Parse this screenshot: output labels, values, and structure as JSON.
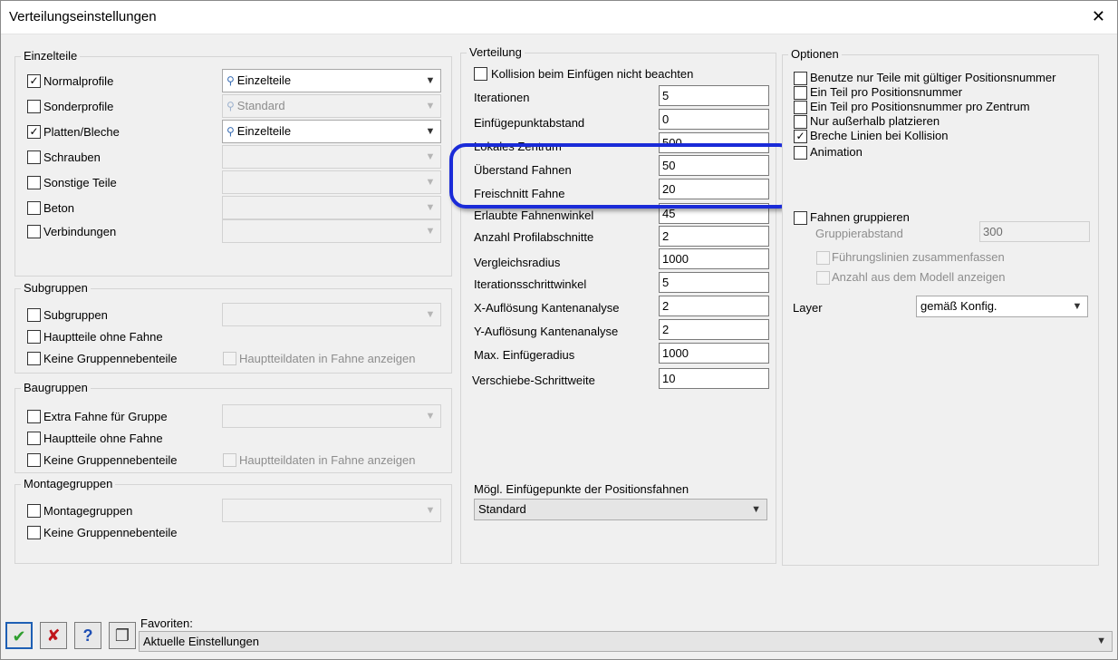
{
  "window": {
    "title": "Verteilungseinstellungen",
    "close": "✕"
  },
  "einzelteile": {
    "title": "Einzelteile",
    "rows": [
      {
        "label": "Normalprofile",
        "checked": "✓",
        "combo": "Einzelteile"
      },
      {
        "label": "Sonderprofile",
        "checked": "",
        "combo": "Standard"
      },
      {
        "label": "Platten/Bleche",
        "checked": "✓",
        "combo": "Einzelteile"
      },
      {
        "label": "Schrauben",
        "checked": "",
        "combo": ""
      },
      {
        "label": "Sonstige Teile",
        "checked": "",
        "combo": ""
      },
      {
        "label": "Beton",
        "checked": "",
        "combo": ""
      },
      {
        "label": "Verbindungen",
        "checked": "",
        "combo": ""
      }
    ]
  },
  "subgruppen": {
    "title": "Subgruppen",
    "subgruppen_label": "Subgruppen",
    "hauptteile_label": "Hauptteile ohne Fahne",
    "keine_label": "Keine Gruppennebenteile",
    "hauptteildaten_label": "Hauptteildaten in Fahne anzeigen"
  },
  "baugruppen": {
    "title": "Baugruppen",
    "extra_label": "Extra Fahne für Gruppe",
    "hauptteile_label": "Hauptteile ohne Fahne",
    "keine_label": "Keine Gruppennebenteile",
    "hauptteildaten_label": "Hauptteildaten in Fahne anzeigen"
  },
  "montagegruppen": {
    "title": "Montagegruppen",
    "montage_label": "Montagegruppen",
    "keine_label": "Keine Gruppennebenteile"
  },
  "verteilung": {
    "title": "Verteilung",
    "kollision_label": "Kollision beim Einfügen nicht beachten",
    "params": [
      {
        "label": "Iterationen",
        "value": "5"
      },
      {
        "label": "Einfügepunktabstand",
        "value": "0"
      },
      {
        "label": "Lokales Zentrum",
        "value": "500"
      },
      {
        "label": "Überstand Fahnen",
        "value": "50"
      },
      {
        "label": "Freischnitt Fahne",
        "value": "20"
      },
      {
        "label": "Erlaubte Fahnenwinkel",
        "value": "45"
      },
      {
        "label": "Anzahl Profilabschnitte",
        "value": "2"
      },
      {
        "label": "Vergleichsradius",
        "value": "1000"
      },
      {
        "label": "Iterationsschrittwinkel",
        "value": "5"
      },
      {
        "label": "X-Auflösung Kantenanalyse",
        "value": "2"
      },
      {
        "label": "Y-Auflösung Kantenanalyse",
        "value": "2"
      },
      {
        "label": "Max. Einfügeradius",
        "value": "1000"
      },
      {
        "label": "Verschiebe-Schrittweite",
        "value": "10"
      }
    ],
    "einfuege_label": "Mögl. Einfügepunkte der Positionsfahnen",
    "einfuege_value": "Standard"
  },
  "optionen": {
    "title": "Optionen",
    "checks": [
      {
        "label": "Benutze nur Teile mit gültiger Positionsnummer",
        "checked": ""
      },
      {
        "label": "Ein Teil pro Positionsnummer",
        "checked": ""
      },
      {
        "label": "Ein Teil pro Positionsnummer pro Zentrum",
        "checked": ""
      },
      {
        "label": "Nur außerhalb platzieren",
        "checked": ""
      },
      {
        "label": "Breche Linien bei Kollision",
        "checked": "✓"
      },
      {
        "label": "Animation",
        "checked": ""
      }
    ],
    "fahnen_gruppieren_label": "Fahnen gruppieren",
    "gruppierabstand_label": "Gruppierabstand",
    "gruppierabstand_value": "300",
    "fuehrungslinien_label": "Führungslinien zusammenfassen",
    "anzahl_label": "Anzahl aus dem Modell anzeigen",
    "layer_label": "Layer",
    "layer_value": "gemäß Konfig."
  },
  "footer": {
    "ok_glyph": "✔",
    "cancel_glyph": "✘",
    "help_glyph": "?",
    "copy_glyph": "❐",
    "favoriten_label": "Favoriten:",
    "favoriten_value": "Aktuelle Einstellungen"
  },
  "colors": {
    "highlight": "#1a2bd8",
    "ok": "#2f9e2f",
    "cancel": "#c0141a",
    "help": "#1e4fb4"
  },
  "icons": {
    "dropdown": "chevron-down-icon",
    "pin": "pin-icon"
  }
}
